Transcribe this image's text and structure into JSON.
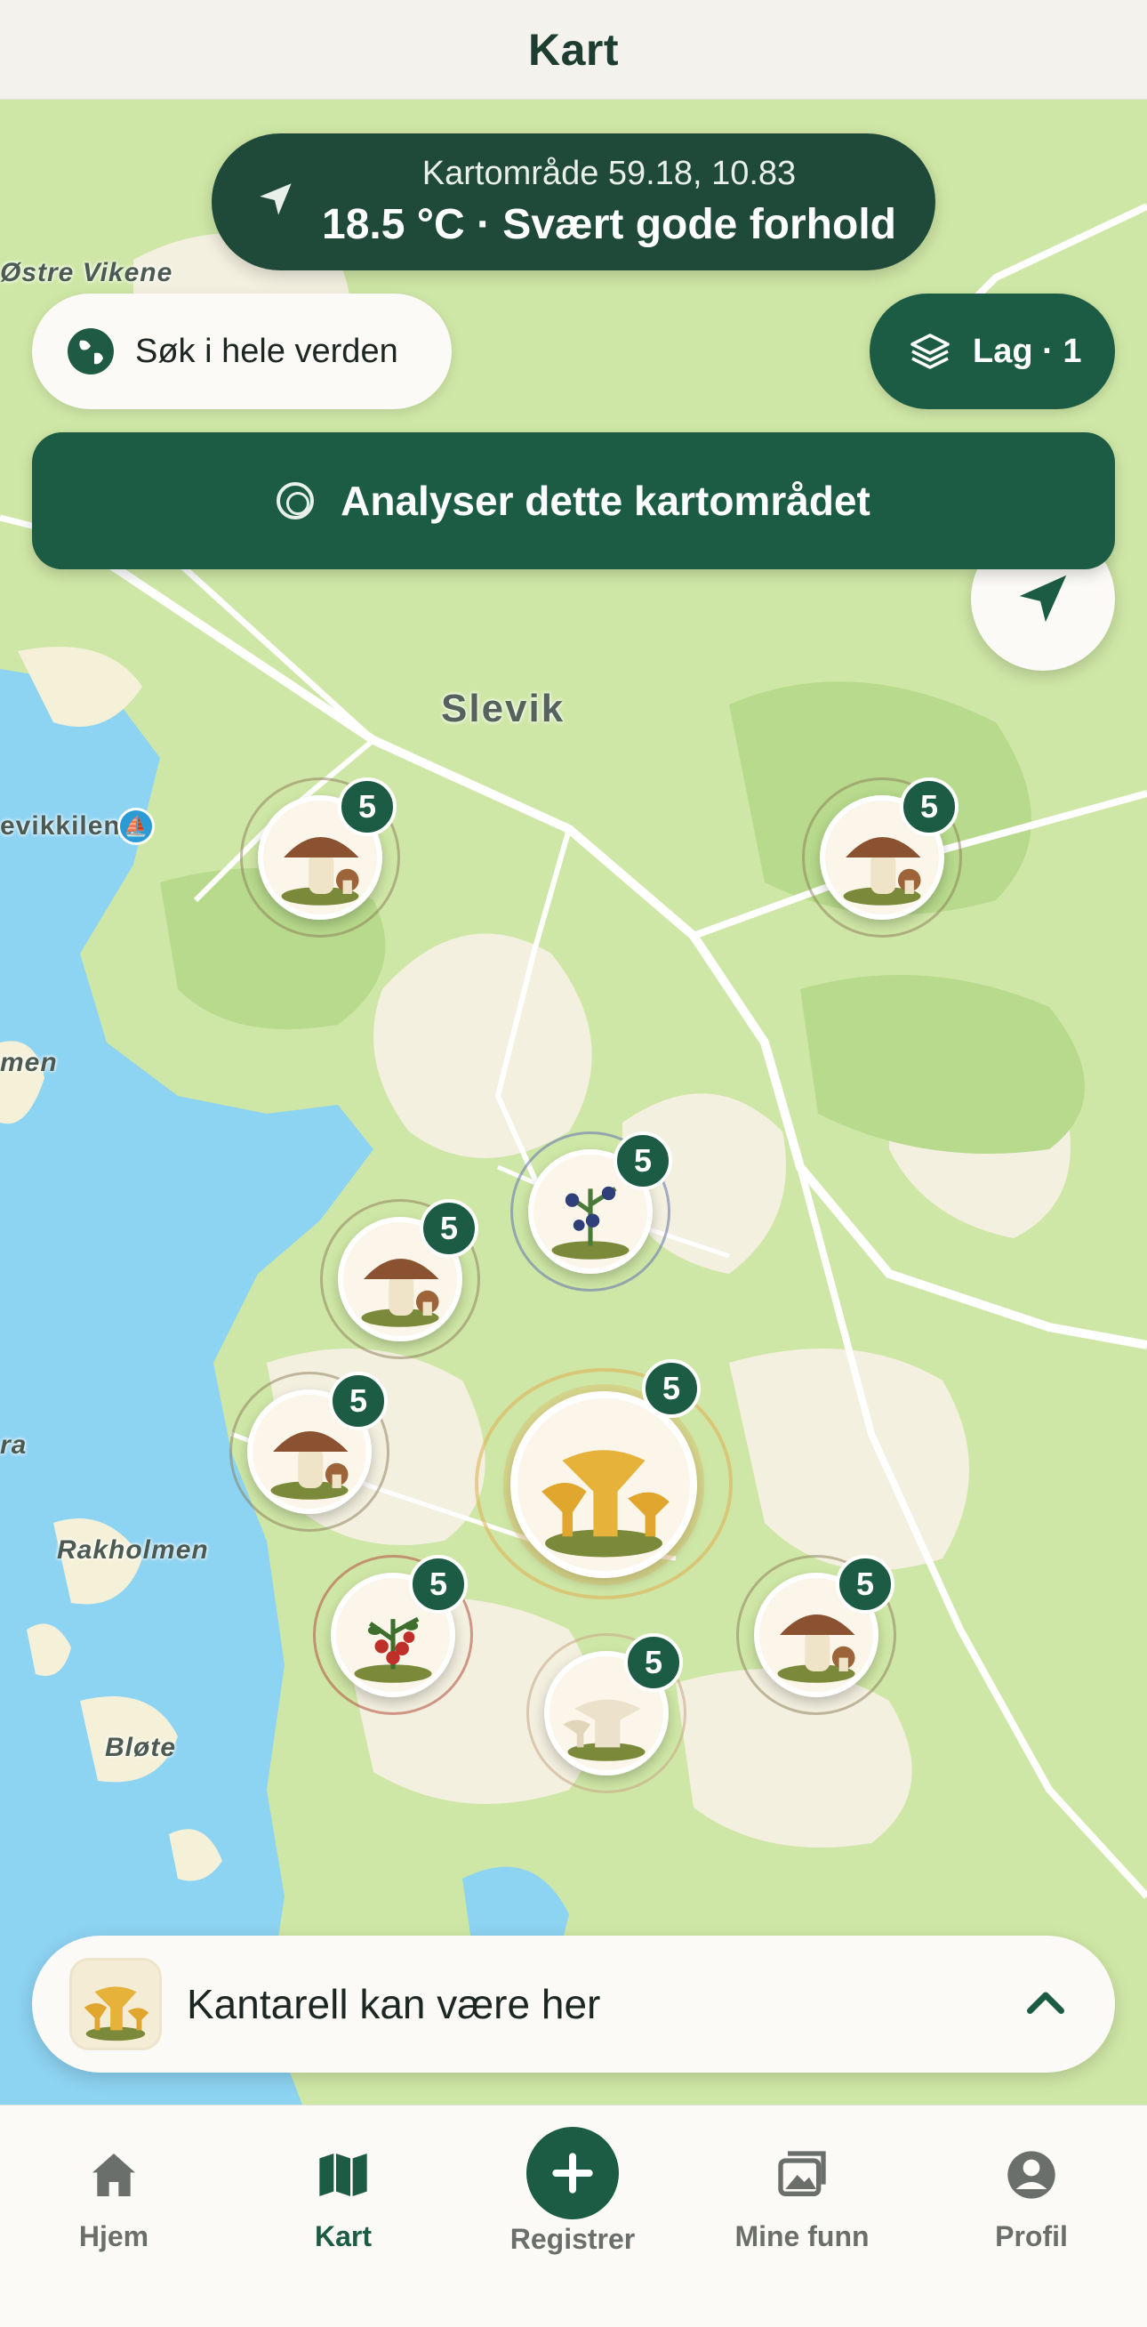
{
  "header": {
    "title": "Kart"
  },
  "area_pill": {
    "subtitle": "Kartområde 59.18, 10.83",
    "conditions": "18.5 °C · Svært gode forhold"
  },
  "search": {
    "label": "Søk i hele verden"
  },
  "layers": {
    "label": "Lag · 1"
  },
  "analyse": {
    "label": "Analyser dette kartområdet"
  },
  "map": {
    "places": [
      "Østre Vikene",
      "Slevik",
      "evikkilen",
      "men",
      "ra",
      "Rakholmen",
      "Bløte"
    ],
    "markers": [
      {
        "species": "steinsopp",
        "count": "5",
        "color": "#8c7a55"
      },
      {
        "species": "steinsopp",
        "count": "5",
        "color": "#8c7a55"
      },
      {
        "species": "blåbær",
        "count": "5",
        "color": "#6a7bb0"
      },
      {
        "species": "steinsopp",
        "count": "5",
        "color": "#8c7a55"
      },
      {
        "species": "kantarell",
        "count": "5",
        "color": "#e0b25a"
      },
      {
        "species": "steinsopp",
        "count": "5",
        "color": "#8c7a55"
      },
      {
        "species": "tyttebær",
        "count": "5",
        "color": "#b85a4a"
      },
      {
        "species": "piggsopp",
        "count": "5",
        "color": "#c9ab8a"
      },
      {
        "species": "steinsopp",
        "count": "5",
        "color": "#8c7a55"
      }
    ]
  },
  "sheet": {
    "label": "Kantarell kan være her"
  },
  "tabs": [
    {
      "label": "Hjem",
      "icon": "home-icon"
    },
    {
      "label": "Kart",
      "icon": "map-icon"
    },
    {
      "label": "Registrer",
      "icon": "plus-icon"
    },
    {
      "label": "Mine funn",
      "icon": "photos-icon"
    },
    {
      "label": "Profil",
      "icon": "person-icon"
    }
  ],
  "colors": {
    "brand": "#1c5c45",
    "pill_dark": "#1f4a3a",
    "water": "#8dd3f2",
    "land": "#cfe7a6"
  }
}
